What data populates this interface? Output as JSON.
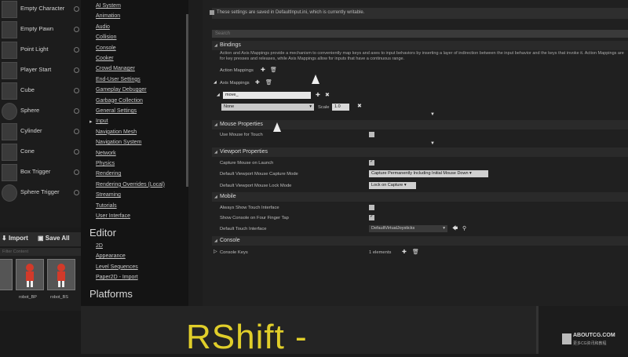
{
  "place_actors": {
    "items": [
      {
        "label": "Empty Character",
        "icon": "empty-character-icon"
      },
      {
        "label": "Empty Pawn",
        "icon": "empty-pawn-icon"
      },
      {
        "label": "Point Light",
        "icon": "point-light-icon"
      },
      {
        "label": "Player Start",
        "icon": "player-start-icon"
      },
      {
        "label": "Cube",
        "icon": "cube-icon"
      },
      {
        "label": "Sphere",
        "icon": "sphere-icon"
      },
      {
        "label": "Cylinder",
        "icon": "cylinder-icon"
      },
      {
        "label": "Cone",
        "icon": "cone-icon"
      },
      {
        "label": "Box Trigger",
        "icon": "box-trigger-icon"
      },
      {
        "label": "Sphere Trigger",
        "icon": "sphere-trigger-icon"
      }
    ]
  },
  "content_browser": {
    "import_label": "Import",
    "save_all_label": "Save All",
    "filter_text": "Filter Content",
    "assets": [
      "robot_BP",
      "robot_BS"
    ]
  },
  "categories": {
    "engine_items": [
      "AI System",
      "Animation",
      "Audio",
      "Collision",
      "Console",
      "Cooker",
      "Crowd Manager",
      "End-User Settings",
      "Gameplay Debugger",
      "Garbage Collection",
      "General Settings",
      "Input",
      "Navigation Mesh",
      "Navigation System",
      "Network",
      "Physics",
      "Rendering",
      "Rendering Overrides (Local)",
      "Streaming",
      "Tutorials",
      "User Interface"
    ],
    "selected": "Input",
    "editor_heading": "Editor",
    "editor_items": [
      "2D",
      "Appearance",
      "Level Sequences",
      "Paper2D - Import"
    ],
    "platforms_heading": "Platforms"
  },
  "settings": {
    "notice": "These settings are saved in DefaultInput.ini, which is currently writable.",
    "search_placeholder": "Search",
    "bindings": {
      "title": "Bindings",
      "description": "Action and Axis Mappings provide a mechanism to conveniently map keys and axes to input behaviors by inserting a layer of indirection between the input behavior and the keys that invoke it. Action Mappings are for key presses and releases, while Axis Mappings allow for inputs that have a continuous range.",
      "action_mappings_label": "Action Mappings",
      "axis_mappings_label": "Axis Mappings",
      "axis_name_value": "move_",
      "key_select_value": "None",
      "scale_label": "Scale",
      "scale_value": "1.0"
    },
    "mouse_properties": {
      "title": "Mouse Properties",
      "use_mouse_for_touch_label": "Use Mouse for Touch",
      "use_mouse_for_touch": false
    },
    "viewport_properties": {
      "title": "Viewport Properties",
      "capture_mouse_label": "Capture Mouse on Launch",
      "capture_mouse": true,
      "capture_mode_label": "Default Viewport Mouse Capture Mode",
      "capture_mode_value": "Capture Permanently Including Initial Mouse Down",
      "lock_mode_label": "Default Viewport Mouse Lock Mode",
      "lock_mode_value": "Lock on Capture"
    },
    "mobile": {
      "title": "Mobile",
      "always_show_touch_label": "Always Show Touch Interface",
      "always_show_touch": false,
      "show_console_label": "Show Console on Four Finger Tap",
      "show_console": true,
      "touch_interface_label": "Default Touch Interface",
      "touch_interface_value": "DefaultVirtualJoysticks"
    },
    "console": {
      "title": "Console",
      "console_keys_label": "Console Keys",
      "console_keys_count": "1 elements"
    }
  },
  "caption": "RShift -",
  "watermark": {
    "title": "ABOUTCG.COM",
    "subtitle": "更多CG资讯和教程"
  }
}
